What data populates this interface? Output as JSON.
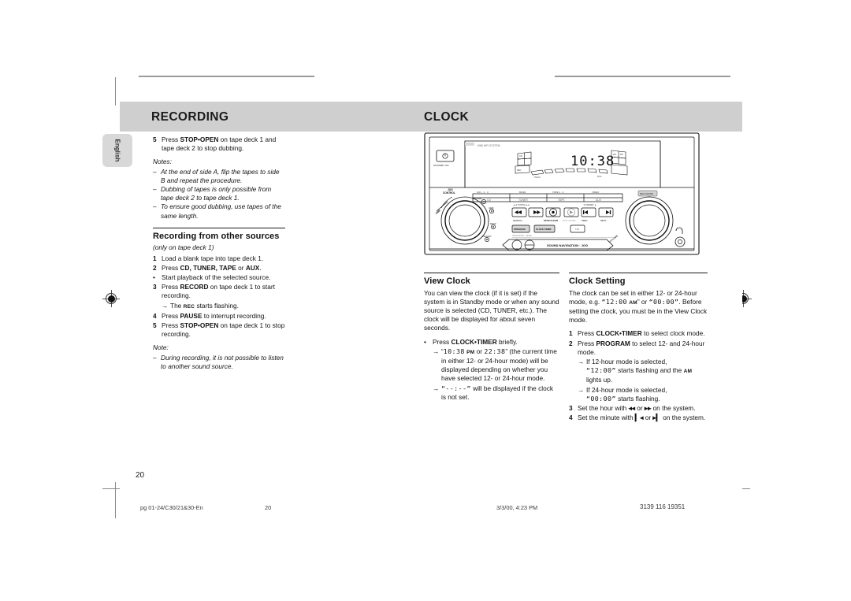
{
  "document": {
    "chapter_left": "RECORDING",
    "chapter_right": "CLOCK",
    "side_tab": "English",
    "folio": "20"
  },
  "footer": {
    "file": "pg 01-24/C30/21&30-En",
    "page": "20",
    "timestamp": "3/3/00, 4:23 PM",
    "doc_number": "3139 116 19351"
  },
  "left_column": {
    "step5": {
      "num": "5",
      "t1": "Press ",
      "kw": "STOP•OPEN",
      "t2": " on tape deck 1 and tape deck 2 to stop dubbing."
    },
    "notes_label": "Notes:",
    "notes": [
      "At the end of side A, flip the tapes to side B and repeat the procedure.",
      "Dubbing of tapes is only possible from tape deck 2 to tape deck 1.",
      "To ensure good dubbing, use tapes of the same length."
    ],
    "section_title": "Recording from other sources",
    "section_sub": "(only on tape deck 1)",
    "steps": [
      {
        "num": "1",
        "t1": "Load a blank tape into tape deck 1.",
        "kw": "",
        "t2": ""
      },
      {
        "num": "2",
        "t1": "Press ",
        "kw": "CD, TUNER, TAPE",
        "t2": " or ",
        "kw2": "AUX",
        "t3": "."
      },
      {
        "num": "•",
        "t1": "Start playback of the selected source.",
        "kw": "",
        "t2": ""
      },
      {
        "num": "3",
        "t1": "Press ",
        "kw": "RECORD",
        "t2": " on tape deck 1 to start recording."
      },
      {
        "num": "4",
        "t1": "Press ",
        "kw": "PAUSE",
        "t2": " to interrupt recording."
      },
      {
        "num": "5",
        "t1": "Press ",
        "kw": "STOP•OPEN",
        "t2": " on tape deck 1 to stop recording."
      }
    ],
    "step3_sub": {
      "arrow": "→",
      "t1": "The ",
      "sc": "REC",
      "t2": " starts flashing."
    },
    "note_label": "Note:",
    "note": "During recording, it is not possible to listen to another sound source."
  },
  "mid_column": {
    "section_title": "View Clock",
    "intro": "You can view the clock (if it is set) if the system is in Standby mode or when any sound source is selected (CD, TUNER, etc.). The clock will be displayed for about seven seconds.",
    "bullet": {
      "num": "•",
      "t1": "Press ",
      "kw": "CLOCK•TIMER",
      "t2": " briefly."
    },
    "sub1": {
      "arrow": "→",
      "q1": "“",
      "lcd1": "10:38",
      "sc": "PM",
      "mid": " or ",
      "lcd2": "22:38",
      "q2": "”",
      "rest": " (the current time in either 12- or 24-hour mode) will be displayed depending on whether you have selected 12- or 24-hour mode."
    },
    "sub2": {
      "arrow": "→",
      "lcd": "“--:--”",
      "rest": " will be displayed if the clock is not set."
    }
  },
  "right_column": {
    "section_title": "Clock Setting",
    "intro_a": "The clock can be set in either 12- or 24-hour mode, e.g. ",
    "intro_lcd1": "“12:00",
    "intro_sc": "AM",
    "intro_b": "” or ",
    "intro_lcd2": "“00:00”",
    "intro_c": ". Before setting the clock, you must be in the View Clock mode.",
    "steps": [
      {
        "num": "1",
        "t1": "Press ",
        "kw": "CLOCK•TIMER",
        "t2": " to select clock mode."
      },
      {
        "num": "2",
        "t1": "Press ",
        "kw": "PROGRAM",
        "t2": " to select 12- and 24-hour mode."
      }
    ],
    "sub_12": {
      "arrow": "→",
      "line1": "If 12-hour mode is selected,",
      "lcd": "“12:00”",
      "mid": " starts flashing and the ",
      "sc": "AM",
      "tail": " lights up."
    },
    "sub_24": {
      "arrow": "→",
      "line1": "If 24-hour mode is selected,",
      "lcd": "“00:00”",
      "tail": " starts flashing."
    },
    "step3": {
      "num": "3",
      "t1": "Set the hour with ",
      "g1": "◂◂",
      "t2": " or ",
      "g2": "▸▸",
      "t3": " on the system."
    },
    "step4": {
      "num": "4",
      "t1": "Set the minute with ",
      "g1": "▎◂",
      "t2": " or ",
      "g2": "▸▎",
      "t3": " on the system."
    }
  },
  "illustration": {
    "alt": "Philips mini hi-fi system front panel",
    "brand_line": "MINI HIFI SYSTEM",
    "standby_label": "STANDBY•ON",
    "jog_label": "JOG CONTROL",
    "display_time": "10:38",
    "source_top": [
      "CD1·2·3",
      "BAND",
      "TAPE 1·2",
      "VIDEO"
    ],
    "source_bottom": [
      "CD",
      "TUNER",
      "TAPE",
      "AUX"
    ],
    "tuning_label": "TUNING",
    "preset_label": "PRESET",
    "transport_labels": [
      "SEARCH",
      "STOP•CLEAR",
      "PLAY•PAUSE",
      "PREV",
      "NEXT"
    ],
    "button_labels": [
      "PROGRAM",
      "CLOCK•TIMER",
      "TIM"
    ],
    "jog_ring_labels": [
      "OPTIMAL",
      "JAZZ",
      "ROCK",
      "TECHNO"
    ],
    "jog_side_label": "DBB",
    "navigation_label": "SOUND NAVIGATION - JOG",
    "volume_label": "VOLUME",
    "level_label": "NAVIGATION · LEVEL",
    "max_sound_label": "MAX SOUND",
    "headphone_icon": "headphone-icon"
  },
  "calibration": {
    "grayscale_wedge": [
      "#050505",
      "#1f1f1f",
      "#333333",
      "#4a4a4a",
      "#5f5f5f",
      "#757575",
      "#8e8e8e",
      "#a6a6a6",
      "#c0c0c0",
      "#e4e4e4",
      "#ffffff"
    ],
    "color_bars": [
      "#ffe800",
      "#e4007f",
      "#0090d7",
      "#3b1177",
      "#009844",
      "#e3001b",
      "#000000",
      "#fdf3b0",
      "#f4a7c0",
      "#9ed2f2",
      "#9b9b9b"
    ]
  }
}
